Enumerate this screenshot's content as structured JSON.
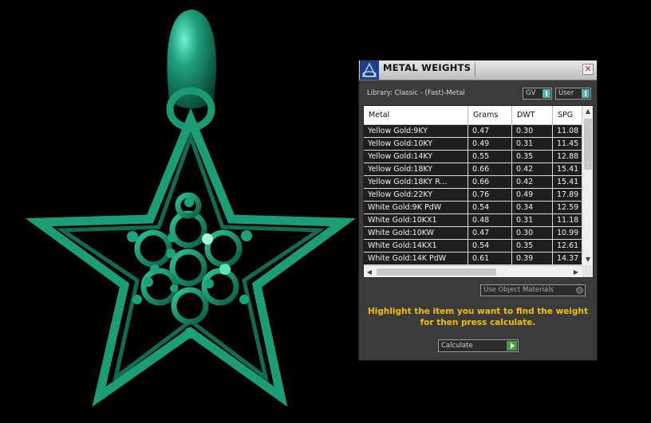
{
  "panel": {
    "title": "METAL WEIGHTS",
    "close_glyph": "✕",
    "library_label": "Library: Classic - (Fast)-Metal",
    "gv_label": "GV",
    "user_label": "User",
    "columns": [
      "Metal",
      "Grams",
      "DWT",
      "SPG"
    ],
    "rows": [
      [
        "Yellow Gold:9KY",
        "0.47",
        "0.30",
        "11.08"
      ],
      [
        "Yellow Gold:10KY",
        "0.49",
        "0.31",
        "11.45"
      ],
      [
        "Yellow Gold:14KY",
        "0.55",
        "0.35",
        "12.88"
      ],
      [
        "Yellow Gold:18KY",
        "0.66",
        "0.42",
        "15.41"
      ],
      [
        "Yellow Gold:18KY R...",
        "0.66",
        "0.42",
        "15.41"
      ],
      [
        "Yellow Gold:22KY",
        "0.76",
        "0.49",
        "17.89"
      ],
      [
        "White Gold:9K PdW",
        "0.54",
        "0.34",
        "12.59"
      ],
      [
        "White Gold:10KX1",
        "0.48",
        "0.31",
        "11.18"
      ],
      [
        "White Gold:10KW",
        "0.47",
        "0.30",
        "10.99"
      ],
      [
        "White Gold:14KX1",
        "0.54",
        "0.35",
        "12.61"
      ],
      [
        "White Gold:14K PdW",
        "0.61",
        "0.39",
        "14.37"
      ]
    ],
    "use_object_materials": "Use Object Materials",
    "hint_line1": "Highlight the item you want to find the weight",
    "hint_line2": "for then press calculate.",
    "calculate_label": "Calculate"
  },
  "colors": {
    "model": "#1f9a78",
    "hint": "#f0c000",
    "panel_bg": "#3b3b3b"
  }
}
